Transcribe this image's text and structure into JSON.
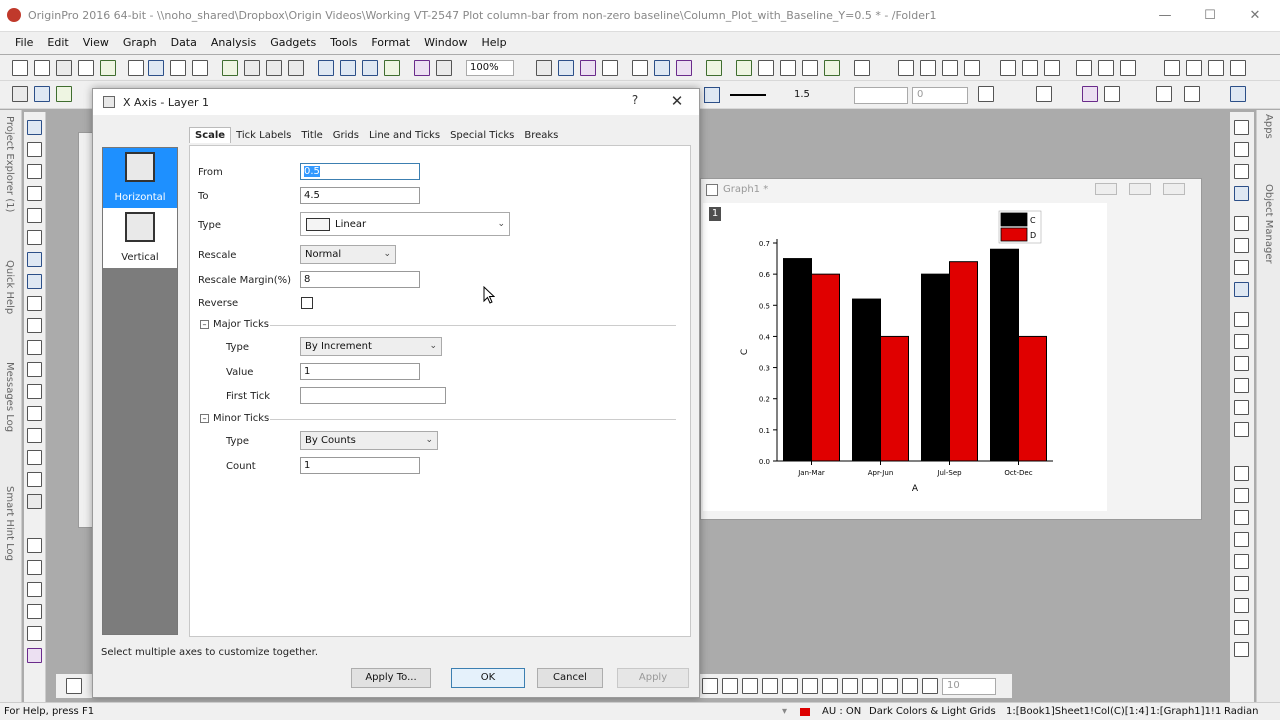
{
  "app": {
    "title": "OriginPro 2016 64-bit - \\\\noho_shared\\Dropbox\\Origin Videos\\Working VT-2547 Plot column-bar from non-zero baseline\\Column_Plot_with_Baseline_Y=0.5 * - /Folder1"
  },
  "menu": [
    "File",
    "Edit",
    "View",
    "Graph",
    "Data",
    "Analysis",
    "Gadgets",
    "Tools",
    "Format",
    "Window",
    "Help"
  ],
  "toolbar": {
    "zoom": "100%",
    "line_width": "1.5",
    "font_size": "0",
    "size_value": "10"
  },
  "side_panels": {
    "project_explorer": "Project Explorer (1)",
    "quick_help": "Quick Help",
    "messages_log": "Messages Log",
    "smart_hint_log": "Smart Hint Log",
    "apps": "Apps",
    "object_manager": "Object Manager"
  },
  "dialog": {
    "title": "X Axis - Layer 1",
    "help": "?",
    "close": "✕",
    "axis_buttons": [
      "Horizontal",
      "Vertical"
    ],
    "tabs": [
      "Scale",
      "Tick Labels",
      "Title",
      "Grids",
      "Line and Ticks",
      "Special Ticks",
      "Breaks"
    ],
    "fields": {
      "from_label": "From",
      "from_value": "0.5",
      "to_label": "To",
      "to_value": "4.5",
      "type_label": "Type",
      "type_value": "Linear",
      "rescale_label": "Rescale",
      "rescale_value": "Normal",
      "rescale_margin_label": "Rescale Margin(%)",
      "rescale_margin_value": "8",
      "reverse_label": "Reverse"
    },
    "major_ticks": {
      "title": "Major Ticks",
      "type_label": "Type",
      "type_value": "By Increment",
      "value_label": "Value",
      "value_value": "1",
      "first_tick_label": "First Tick",
      "first_tick_value": ""
    },
    "minor_ticks": {
      "title": "Minor Ticks",
      "type_label": "Type",
      "type_value": "By Counts",
      "count_label": "Count",
      "count_value": "1"
    },
    "hint": "Select multiple axes to customize together.",
    "buttons": {
      "apply_to": "Apply To...",
      "ok": "OK",
      "cancel": "Cancel",
      "apply": "Apply"
    }
  },
  "graph_window": {
    "title": "Graph1 *",
    "layer_label": "1"
  },
  "chart_data": {
    "type": "bar",
    "categories": [
      "Jan-Mar",
      "Apr-Jun",
      "Jul-Sep",
      "Oct-Dec"
    ],
    "series": [
      {
        "name": "C",
        "values": [
          0.65,
          0.52,
          0.6,
          0.68
        ],
        "color": "#000000"
      },
      {
        "name": "D",
        "values": [
          0.6,
          0.4,
          0.64,
          0.4
        ],
        "color": "#e00000"
      }
    ],
    "xlabel": "A",
    "ylabel": "C",
    "ylim": [
      0.0,
      0.7
    ],
    "yticks": [
      "0.0",
      "0.1",
      "0.2",
      "0.3",
      "0.4",
      "0.5",
      "0.6",
      "0.7"
    ],
    "legend": "top-right",
    "grid": false
  },
  "status": {
    "left": "For Help, press F1",
    "au": "AU : ON",
    "theme": "Dark Colors & Light Grids",
    "book": "1:[Book1]Sheet1!Col(C)[1:4]",
    "graph": "1:[Graph1]1!1",
    "angle": "Radian"
  }
}
